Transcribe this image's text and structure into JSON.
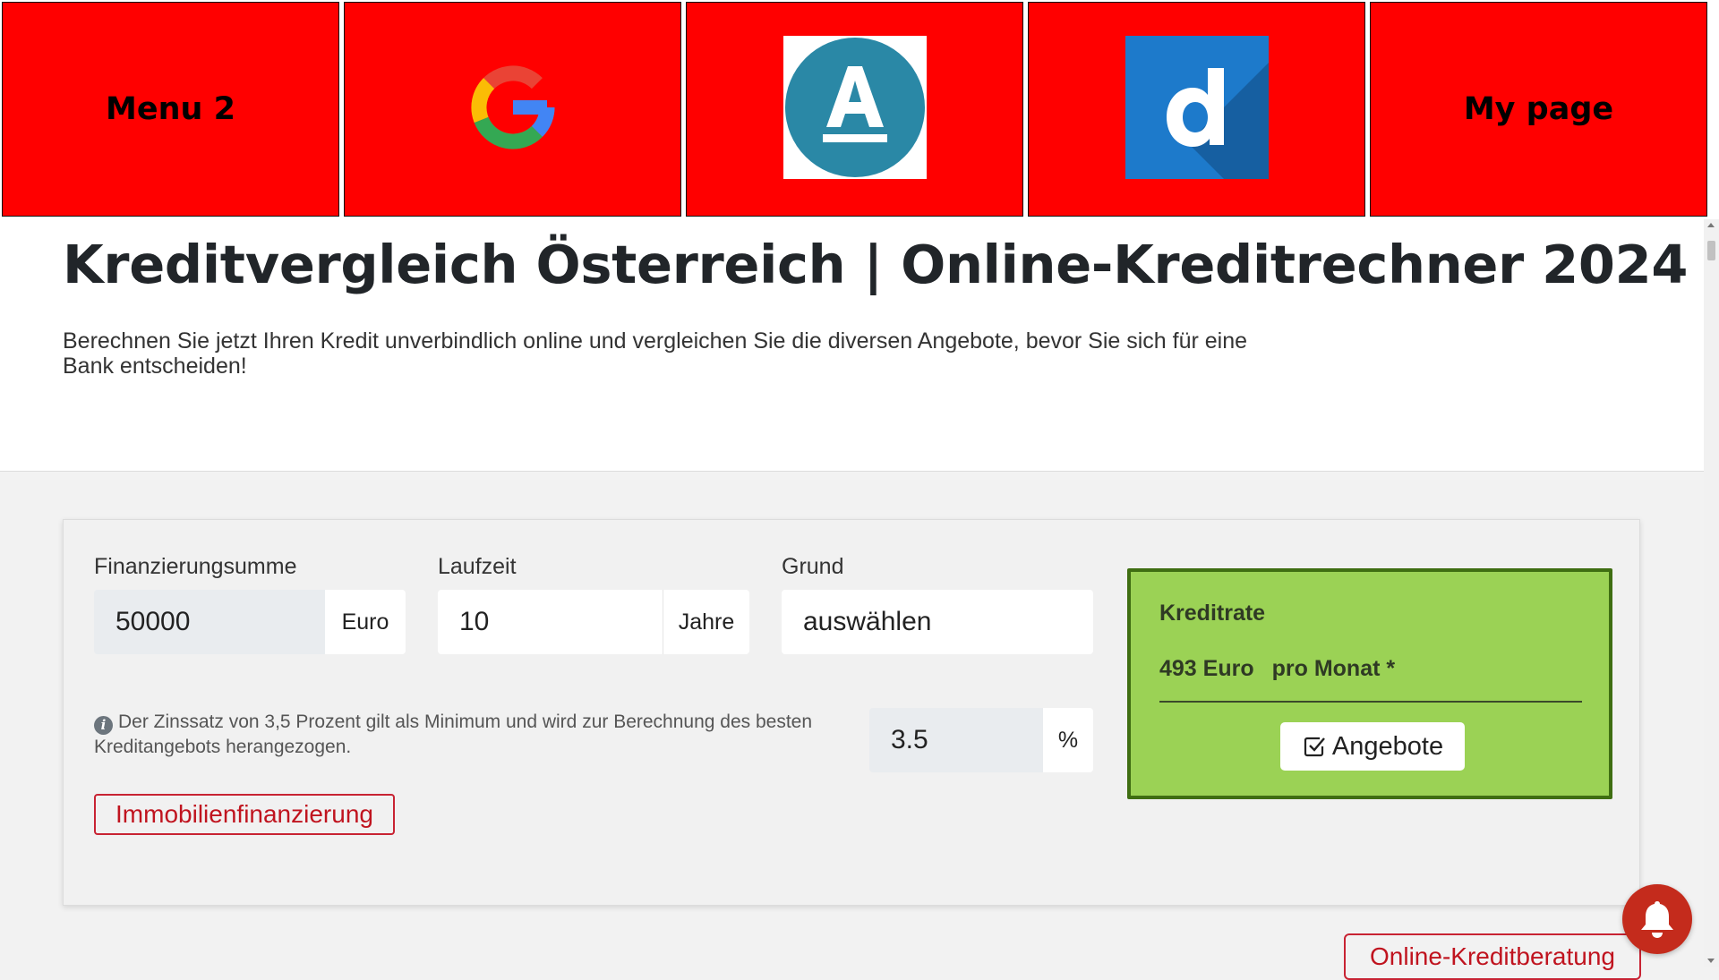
{
  "menu": {
    "items": [
      {
        "label": "Menu 2",
        "type": "text"
      },
      {
        "icon": "google-icon",
        "type": "icon"
      },
      {
        "icon": "amazon-a-icon",
        "type": "icon"
      },
      {
        "icon": "d-app-icon",
        "type": "icon"
      },
      {
        "label": "My page",
        "type": "text"
      }
    ],
    "tile_color": "#ff0000"
  },
  "header": {
    "title": "Kreditvergleich Österreich | Online-Kreditrechner 2024",
    "subtitle": "Berechnen Sie jetzt Ihren Kredit unverbindlich online und vergleichen Sie die diversen Angebote, bevor Sie sich für eine Bank entscheiden!"
  },
  "calculator": {
    "amount": {
      "label": "Finanzierungsumme",
      "value": "50000",
      "unit": "Euro"
    },
    "duration": {
      "label": "Laufzeit",
      "value": "10",
      "unit": "Jahre"
    },
    "reason": {
      "label": "Grund",
      "value": "auswählen"
    },
    "interest": {
      "info": "Der Zinssatz von 3,5 Prozent gilt als Minimum und wird zur Berechnung des besten Kreditangebots herangezogen.",
      "value": "3.5",
      "unit": "%"
    },
    "real_estate_button": "Immobilienfinanzierung"
  },
  "result": {
    "title": "Kreditrate",
    "amount": "493 Euro",
    "period": "pro Monat *",
    "offers_button": "Angebote",
    "bg_color": "#9bd255",
    "border_color": "#3f6e12"
  },
  "footer": {
    "consult_button": "Online-Kreditberatung",
    "notification_icon": "bell-icon"
  },
  "colors": {
    "accent_red": "#c82333"
  }
}
